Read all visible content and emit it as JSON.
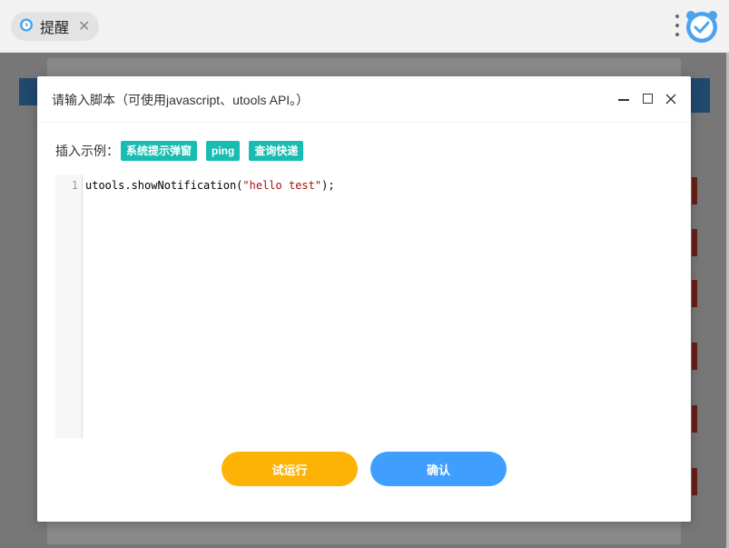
{
  "window": {
    "tab_label": "提醒",
    "tab_close": "✕"
  },
  "dialog": {
    "title": "请输入脚本（可使用javascript、utools API。）",
    "insert_label": "插入示例：",
    "examples": [
      "系统提示弹窗",
      "ping",
      "查询快递"
    ],
    "editor": {
      "line_numbers": [
        "1"
      ],
      "code_prefix": "utools.showNotification(",
      "code_string": "\"hello test\"",
      "code_suffix": ");"
    },
    "run_button": "试运行",
    "confirm_button": "确认"
  },
  "colors": {
    "tag": "#19bcb0",
    "run": "#fdb305",
    "confirm": "#409eff"
  }
}
